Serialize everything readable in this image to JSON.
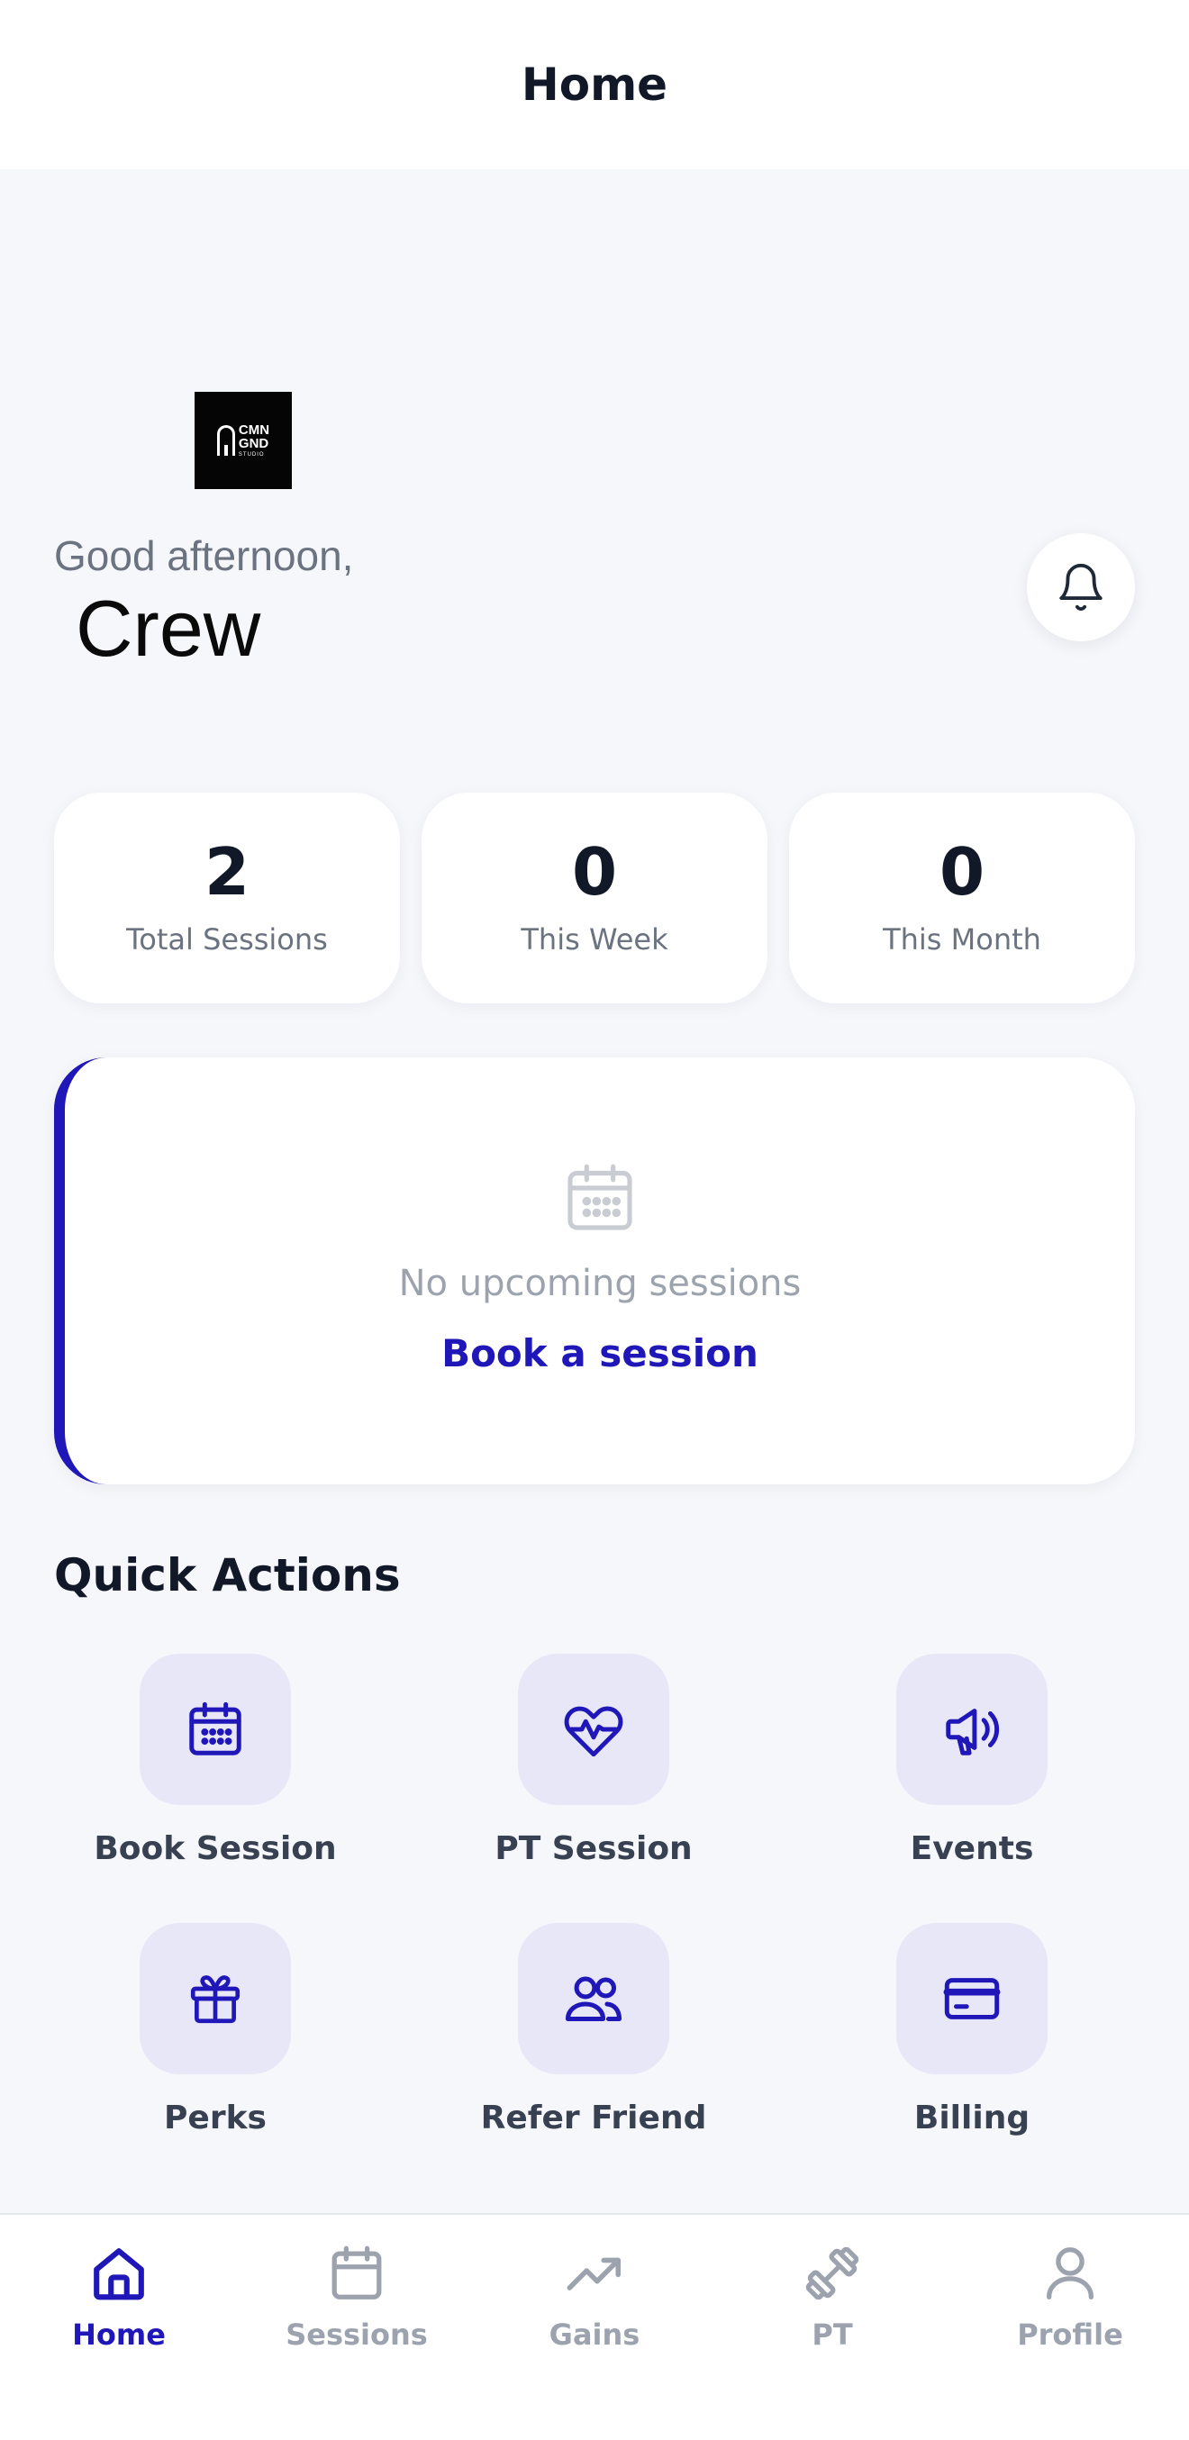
{
  "header": {
    "title": "Home"
  },
  "brand": {
    "logo_text": [
      "CMN",
      "GND"
    ],
    "logo_sub": "STUDIO"
  },
  "greeting": {
    "salutation": "Good afternoon,",
    "name": "Crew"
  },
  "stats": [
    {
      "value": "2",
      "label": "Total Sessions"
    },
    {
      "value": "0",
      "label": "This Week"
    },
    {
      "value": "0",
      "label": "This Month"
    }
  ],
  "upcoming": {
    "empty_text": "No upcoming sessions",
    "cta": "Book a session"
  },
  "quick_actions": {
    "title": "Quick Actions",
    "items": [
      {
        "label": "Book Session",
        "icon": "calendar-icon"
      },
      {
        "label": "PT Session",
        "icon": "heart-pulse-icon"
      },
      {
        "label": "Events",
        "icon": "megaphone-icon"
      },
      {
        "label": "Perks",
        "icon": "gift-icon"
      },
      {
        "label": "Refer Friend",
        "icon": "users-icon"
      },
      {
        "label": "Billing",
        "icon": "credit-card-icon"
      }
    ]
  },
  "nav": {
    "items": [
      {
        "label": "Home",
        "icon": "home-icon",
        "active": true
      },
      {
        "label": "Sessions",
        "icon": "calendar-icon"
      },
      {
        "label": "Gains",
        "icon": "trending-up-icon"
      },
      {
        "label": "PT",
        "icon": "dumbbell-icon"
      },
      {
        "label": "Profile",
        "icon": "user-icon"
      }
    ]
  },
  "colors": {
    "accent": "#1f17b8",
    "muted": "#9ca3af",
    "icon_bg": "#e8e7f8",
    "page_bg": "#f6f7fb"
  }
}
